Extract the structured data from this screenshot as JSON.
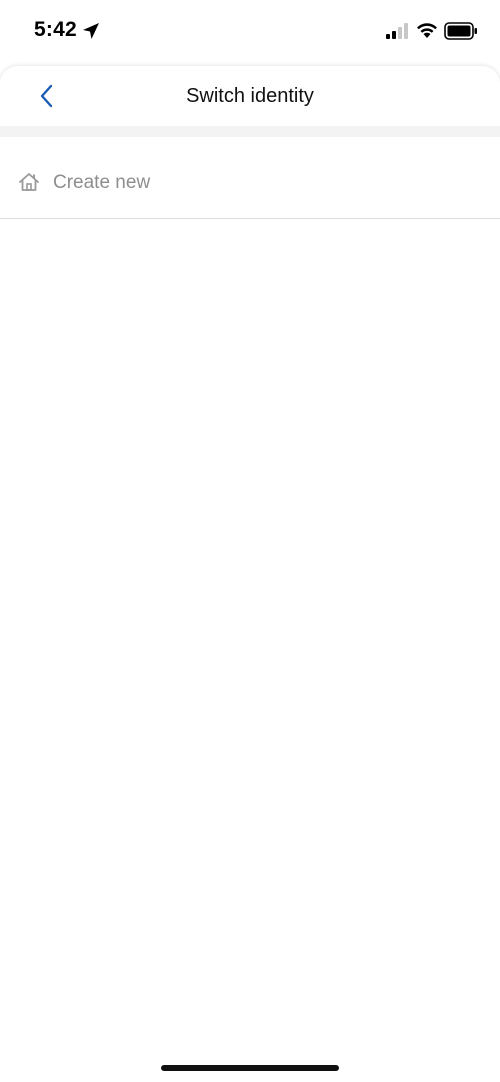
{
  "status_bar": {
    "time": "5:42",
    "icons": [
      "location-arrow-icon",
      "cellular-signal-icon",
      "wifi-icon",
      "battery-icon"
    ]
  },
  "header": {
    "title": "Switch identity",
    "back_icon": "chevron-left-icon"
  },
  "list": {
    "items": [
      {
        "icon": "home-icon",
        "label": "Create new"
      }
    ]
  },
  "colors": {
    "accent": "#1a5fb4",
    "text_primary": "#111111",
    "text_muted": "#8e8e8e",
    "divider_band": "#f3f3f3"
  }
}
